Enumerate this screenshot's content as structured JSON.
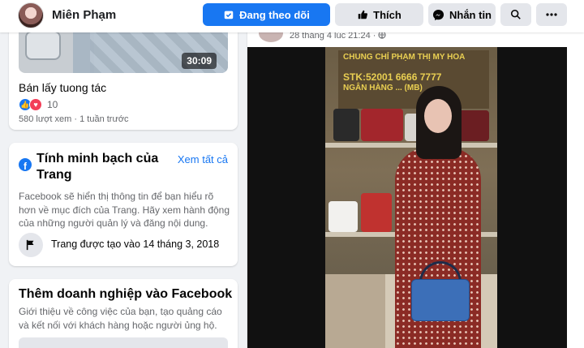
{
  "header": {
    "page_name": "Miên Phạm",
    "follow_label": "Đang theo dõi",
    "like_label": "Thích",
    "message_label": "Nhắn tin"
  },
  "video_card": {
    "duration": "30:09",
    "title": "Bán lấy tuong tác",
    "reaction_count": "10",
    "meta": "580 lượt xem · 1 tuần trước"
  },
  "transparency": {
    "title": "Tính minh bạch của Trang",
    "see_all": "Xem tất cả",
    "description": "Facebook sẽ hiển thị thông tin để bạn hiểu rõ hơn về mục đích của Trang. Hãy xem hành động của những người quản lý và đăng nội dung.",
    "created": "Trang được tạo vào 14 tháng 3, 2018"
  },
  "business": {
    "title": "Thêm doanh nghiệp vào Facebook",
    "description": "Giới thiệu về công việc của bạn, tạo quảng cáo và kết nối với khách hàng hoặc người ủng hộ."
  },
  "post": {
    "timestamp": "28 tháng 4 lúc 21:24 ·",
    "sign_line1": "CHUNG CHỈ PHẠM THỊ MY HOA",
    "sign_stk": "STK:52001 6666 7777",
    "sign_line3": "NGÂN HÀNG ... (MB)"
  },
  "colors": {
    "primary": "#1877f2",
    "button_gray": "#e4e6eb",
    "page_bg": "#f0f2f5"
  }
}
